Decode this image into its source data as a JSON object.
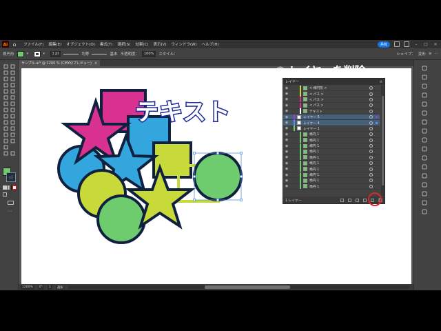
{
  "menubar": {
    "items": [
      "ファイル(F)",
      "編集(E)",
      "オブジェクト(O)",
      "書式(T)",
      "選択(S)",
      "効果(C)",
      "表示(V)",
      "ウィンドウ(W)",
      "ヘルプ(H)"
    ],
    "share_label": "共有"
  },
  "controlbar": {
    "selection_label": "楕円形",
    "stroke_weight": "1 pt",
    "profile_label": "均等",
    "brush_label": "基本",
    "opacity_label": "不透明度：",
    "opacity_value": "100%",
    "style_label": "スタイル：",
    "shape_label": "シェイプ：",
    "transform_label": "変形",
    "colors": {
      "fill": "#6ecc6e",
      "stroke": "#1d2b4a"
    }
  },
  "document_tab": {
    "title": "サンプル.ai* @ 1200 % (CMYK/プレビュー)",
    "close": "×"
  },
  "statusbar": {
    "zoom": "1200%",
    "rotation": "0°",
    "page": "1",
    "tool": "選択"
  },
  "artwork": {
    "heading_text": "テキスト",
    "colors": {
      "outline": "#10213f",
      "magenta": "#d9318f",
      "cyan": "#33a6dd",
      "lime": "#c8d93a",
      "green": "#6ecc6e",
      "text_fill": "#ffffff",
      "text_outline": "#1c2a9a"
    }
  },
  "layers_panel": {
    "title": "レイヤー",
    "footer_label": "1 レイヤー",
    "rows": [
      {
        "name": "< 楕円形 >",
        "indent": 1,
        "color": "#c8d93a",
        "selected": false
      },
      {
        "name": "< パス >",
        "indent": 1,
        "color": "#c8d93a",
        "selected": false
      },
      {
        "name": "< パス >",
        "indent": 1,
        "color": "#d9318f",
        "selected": false
      },
      {
        "name": "< パス >",
        "indent": 1,
        "color": "#d9318f",
        "selected": false
      },
      {
        "name": "テキスト",
        "indent": 1,
        "color": "#ffffff",
        "selected": false
      },
      {
        "name": "レイヤー 5",
        "indent": 0,
        "color": "#9b3dd6",
        "selected": true
      },
      {
        "name": "レイヤー 4",
        "indent": 0,
        "color": "#5b8fd9",
        "selected": true
      },
      {
        "name": "レイヤー 1",
        "indent": 0,
        "color": "#6ecc6e",
        "selected": false
      },
      {
        "name": "楕円 1",
        "indent": 1,
        "color": "#6ecc6e",
        "selected": false
      },
      {
        "name": "楕円 1",
        "indent": 1,
        "color": "#6ecc6e",
        "selected": false
      },
      {
        "name": "楕円 1",
        "indent": 1,
        "color": "#6ecc6e",
        "selected": false
      },
      {
        "name": "楕円 1",
        "indent": 1,
        "color": "#6ecc6e",
        "selected": false
      },
      {
        "name": "楕円 1",
        "indent": 1,
        "color": "#6ecc6e",
        "selected": false
      },
      {
        "name": "楕円 1",
        "indent": 1,
        "color": "#6ecc6e",
        "selected": false
      },
      {
        "name": "楕円 1",
        "indent": 1,
        "color": "#6ecc6e",
        "selected": false
      },
      {
        "name": "楕円 1",
        "indent": 1,
        "color": "#6ecc6e",
        "selected": false
      },
      {
        "name": "楕円 1",
        "indent": 1,
        "color": "#6ecc6e",
        "selected": false
      },
      {
        "name": "楕円 1",
        "indent": 1,
        "color": "#6ecc6e",
        "selected": false
      }
    ],
    "icons": [
      "eye-icon",
      "target-icon",
      "trash-icon",
      "new-layer-icon",
      "locate-object-icon"
    ]
  },
  "annotation": {
    "caption": "⑧ レイヤーを削除",
    "highlight_color": "#e0242f"
  }
}
